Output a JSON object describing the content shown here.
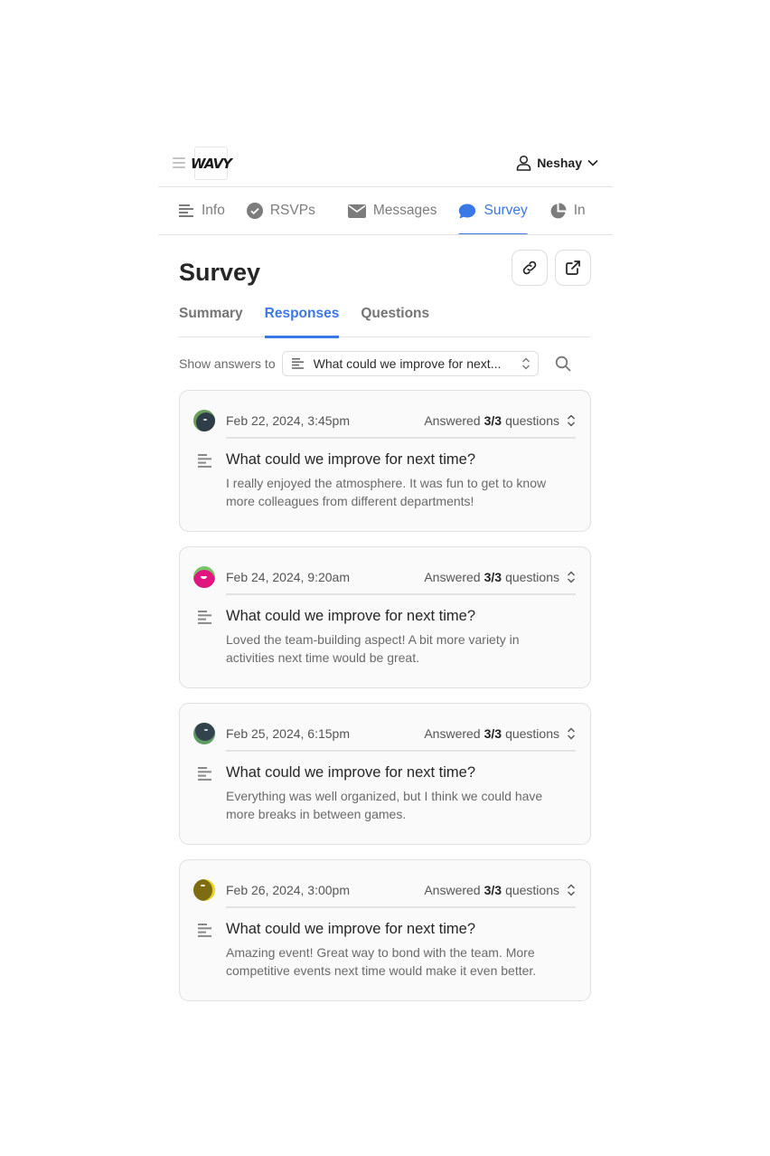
{
  "header": {
    "logo_text": "WAVY",
    "user_name": "Neshay"
  },
  "nav": {
    "tabs": [
      {
        "label": "Info",
        "icon": "lines-icon"
      },
      {
        "label": "RSVPs",
        "icon": "check-circle-icon"
      },
      {
        "label": "Messages",
        "icon": "envelope-icon"
      },
      {
        "label": "Survey",
        "icon": "chat-bubble-icon",
        "active": true
      },
      {
        "label": "In",
        "icon": "pie-chart-icon"
      }
    ]
  },
  "page": {
    "title": "Survey"
  },
  "subtabs": [
    "Summary",
    "Responses",
    "Questions"
  ],
  "filter": {
    "label": "Show answers to",
    "selected": "What could we improve for next..."
  },
  "responses": [
    {
      "date": "Feb 22, 2024, 3:45pm",
      "answered_prefix": "Answered",
      "answered_count": "3/3",
      "answered_suffix": "questions",
      "question": "What could we improve for next time?",
      "answer": "I really enjoyed the atmosphere. It was fun to get to know more colleagues from different departments!",
      "avatar_colors": [
        "#6a9e5a",
        "#2f3d48"
      ]
    },
    {
      "date": "Feb 24, 2024, 9:20am",
      "answered_prefix": "Answered",
      "answered_count": "3/3",
      "answered_suffix": "questions",
      "question": "What could we improve for next time?",
      "answer": "Loved the team-building aspect! A bit more variety in activities next time would be great.",
      "avatar_colors": [
        "#7ac36a",
        "#e0157f"
      ]
    },
    {
      "date": "Feb 25, 2024, 6:15pm",
      "answered_prefix": "Answered",
      "answered_count": "3/3",
      "answered_suffix": "questions",
      "question": "What could we improve for next time?",
      "answer": "Everything was well organized, but I think we could have more breaks in between games.",
      "avatar_colors": [
        "#5f9a62",
        "#33434e"
      ]
    },
    {
      "date": "Feb 26, 2024, 3:00pm",
      "answered_prefix": "Answered",
      "answered_count": "3/3",
      "answered_suffix": "questions",
      "question": "What could we improve for next time?",
      "answer": "Amazing event! Great way to bond with the team. More competitive events next time would make it even better.",
      "avatar_colors": [
        "#e8d22a",
        "#7d6c12"
      ]
    }
  ],
  "colors": {
    "accent": "#3b78e7",
    "border": "#e0e0e0",
    "muted_text": "#6a6a6a"
  }
}
